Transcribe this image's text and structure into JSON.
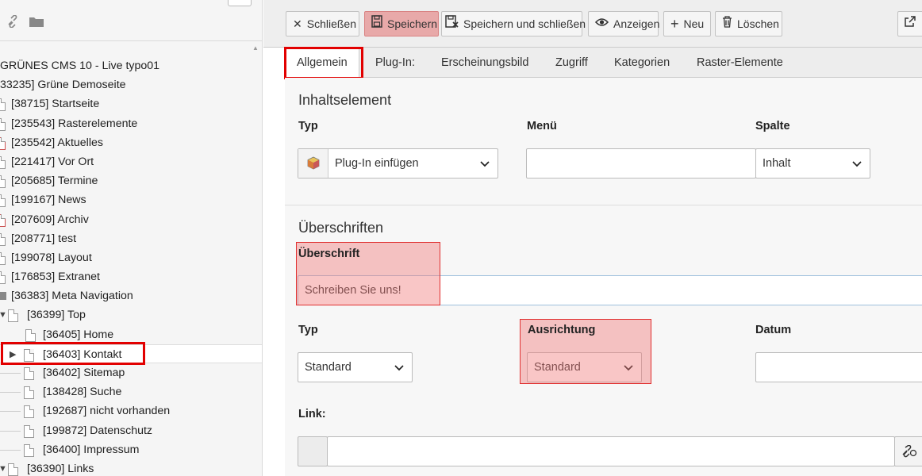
{
  "tree": {
    "rows": [
      {
        "label": "GRÜNES CMS 10 - Live typo01"
      },
      {
        "label": "33235] Grüne Demoseite"
      },
      {
        "label": "[38715] Startseite"
      },
      {
        "label": "[235543] Rasterelemente"
      },
      {
        "label": "[235542] Aktuelles"
      },
      {
        "label": "[221417] Vor Ort"
      },
      {
        "label": "[205685] Termine"
      },
      {
        "label": "[199167] News"
      },
      {
        "label": "[207609] Archiv"
      },
      {
        "label": "[208771] test"
      },
      {
        "label": "[199078] Layout"
      },
      {
        "label": "[176853] Extranet"
      },
      {
        "label": "[36383] Meta Navigation"
      },
      {
        "label": "[36399] Top"
      },
      {
        "label": "[36405] Home"
      },
      {
        "label": "[36403] Kontakt"
      },
      {
        "label": "[36402] Sitemap"
      },
      {
        "label": "[138428] Suche"
      },
      {
        "label": "[192687] nicht vorhanden"
      },
      {
        "label": "[199872] Datenschutz"
      },
      {
        "label": "[36400] Impressum"
      },
      {
        "label": "[36390] Links"
      }
    ]
  },
  "toolbar": {
    "close": "Schließen",
    "save": "Speichern",
    "save_close": "Speichern und schließen",
    "view": "Anzeigen",
    "new": "Neu",
    "delete": "Löschen"
  },
  "tabs": [
    "Allgemein",
    "Plug-In:",
    "Erscheinungsbild",
    "Zugriff",
    "Kategorien",
    "Raster-Elemente"
  ],
  "form": {
    "section1_title": "Inhaltselement",
    "typ_label": "Typ",
    "typ_value": "Plug-In einfügen",
    "menu_label": "Menü",
    "menu_value": "",
    "spalte_label": "Spalte",
    "spalte_value": "Inhalt",
    "section2_title": "Überschriften",
    "ueberschrift_label": "Überschrift",
    "ueberschrift_value": "Schreiben Sie uns!",
    "htyp_label": "Typ",
    "htyp_value": "Standard",
    "ausrichtung_label": "Ausrichtung",
    "ausrichtung_value": "Standard",
    "datum_label": "Datum",
    "datum_value": "",
    "link_label": "Link:",
    "link_value": ""
  },
  "colors": {
    "save_bg": "#e8a9a9",
    "highlight_red": "#e20000"
  },
  "icons": [
    "link-icon",
    "folder-icon",
    "close-icon",
    "save-icon",
    "save-close-icon",
    "eye-icon",
    "plus-icon",
    "trash-icon",
    "open-window-icon",
    "plugin-cube-icon",
    "link-wizard-icon",
    "page-icon",
    "chevron-down-icon"
  ]
}
